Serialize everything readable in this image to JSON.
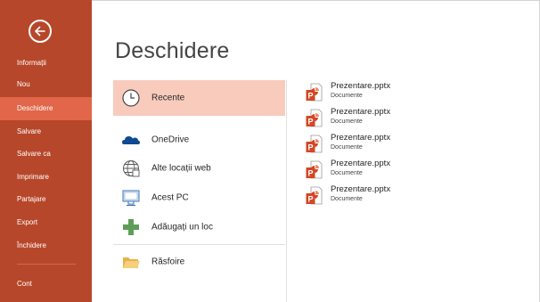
{
  "nav": {
    "items": [
      {
        "label": "Informații"
      },
      {
        "label": "Nou"
      },
      {
        "label": "Deschidere"
      },
      {
        "label": "Salvare"
      },
      {
        "label": "Salvare ca"
      },
      {
        "label": "Imprimare"
      },
      {
        "label": "Partajare"
      },
      {
        "label": "Export"
      },
      {
        "label": "Închidere"
      },
      {
        "label": "Cont"
      }
    ],
    "active": "Deschidere"
  },
  "main": {
    "title": "Deschidere",
    "locations": [
      {
        "label": "Recente",
        "icon": "clock-icon"
      },
      {
        "label": "OneDrive",
        "icon": "onedrive-cloud-icon"
      },
      {
        "label": "Alte locații web",
        "icon": "globe-icon"
      },
      {
        "label": "Acest PC",
        "icon": "computer-icon"
      },
      {
        "label": "Adăugați un loc",
        "icon": "plus-icon"
      },
      {
        "label": "Răsfoire",
        "icon": "folder-icon"
      }
    ],
    "files": [
      {
        "name": "Prezentare.pptx",
        "path": "Documente"
      },
      {
        "name": "Prezentare.pptx",
        "path": "Documente"
      },
      {
        "name": "Prezentare.pptx",
        "path": "Documente"
      },
      {
        "name": "Prezentare.pptx",
        "path": "Documente"
      },
      {
        "name": "Prezentare.pptx",
        "path": "Documente"
      }
    ]
  },
  "colors": {
    "nav_bg": "#b7472a",
    "nav_active": "#e1664a",
    "selected_location": "#f9cbbc",
    "onedrive_blue": "#0f4a92",
    "ppt_red": "#d24726",
    "add_green": "#5e9e58"
  }
}
